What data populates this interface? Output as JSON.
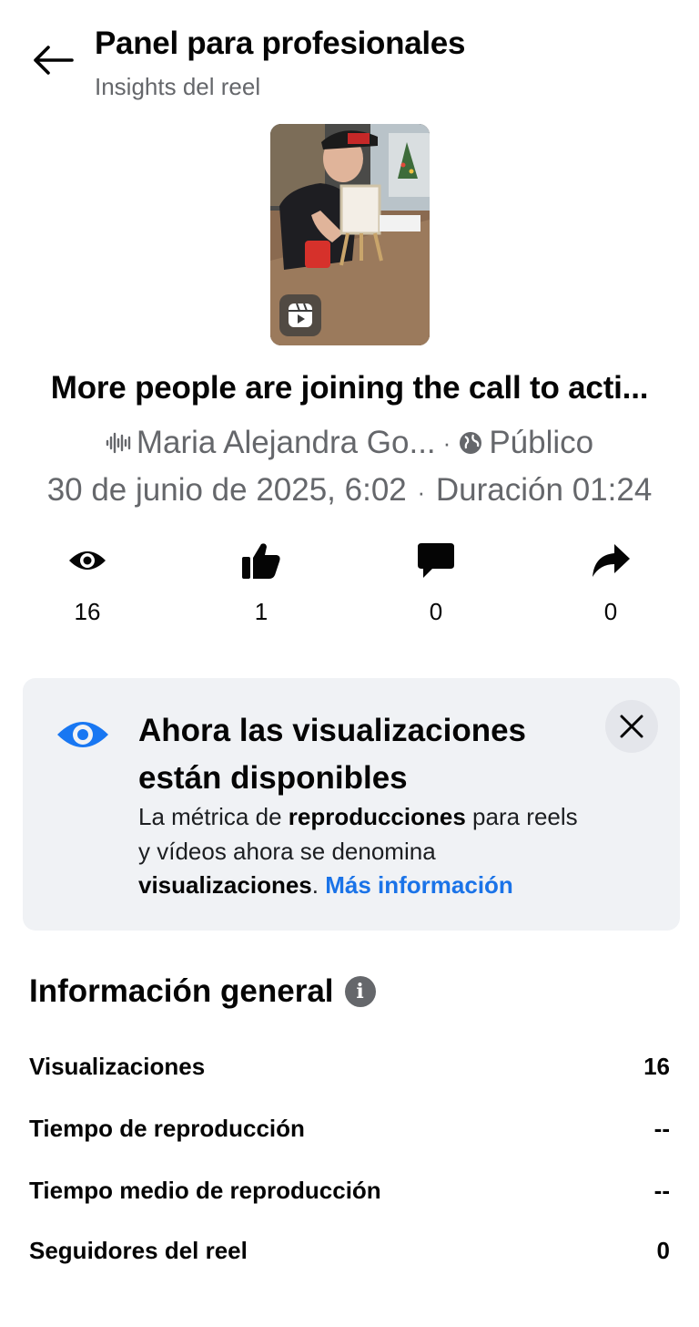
{
  "header": {
    "title": "Panel para profesionales",
    "subtitle": "Insights del reel"
  },
  "post": {
    "title": "More people are joining the call to acti...",
    "author": "Maria Alejandra Go...",
    "separator": "·",
    "audience": "Público",
    "date": "30 de junio de 2025, 6:02",
    "duration": "Duración 01:24"
  },
  "stats": [
    {
      "icon": "eye-icon",
      "value": "16"
    },
    {
      "icon": "thumbs-up-icon",
      "value": "1"
    },
    {
      "icon": "comment-icon",
      "value": "0"
    },
    {
      "icon": "share-icon",
      "value": "0"
    }
  ],
  "banner": {
    "title": "Ahora las visualizaciones están disponibles",
    "body_1": "La métrica de ",
    "body_bold_1": "reproducciones",
    "body_2": " para reels y vídeos ahora se denomina ",
    "body_bold_2": "visualizaciones",
    "body_3": ". ",
    "link": "Más información"
  },
  "overview": {
    "title": "Información general",
    "info_glyph": "i",
    "rows": [
      {
        "label": "Visualizaciones",
        "value": "16"
      },
      {
        "label": "Tiempo de reproducción",
        "value": "--"
      },
      {
        "label": "Tiempo medio de reproducción",
        "value": "--"
      },
      {
        "label": "Seguidores del reel",
        "value": "0"
      }
    ]
  },
  "colors": {
    "accent": "#1877f2",
    "link": "#1a73e8",
    "muted": "#65676b",
    "banner_bg": "#f0f2f5"
  }
}
